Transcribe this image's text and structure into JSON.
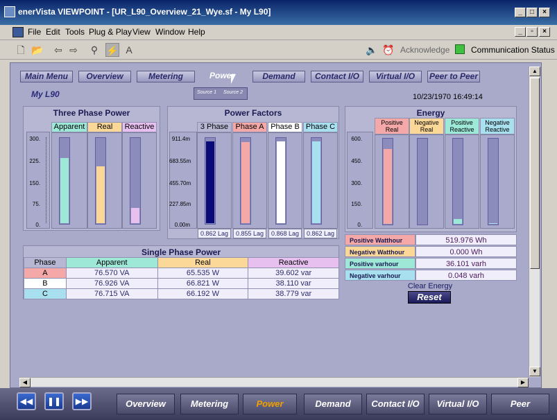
{
  "window": {
    "title": "enerVista VIEWPOINT - [UR_L90_Overview_21_Wye.sf - My L90]"
  },
  "menu": [
    "File",
    "Edit",
    "Tools",
    "Plug & Play",
    "View",
    "Window",
    "Help"
  ],
  "toolbar": {
    "acknowledge": "Acknowledge",
    "comm_status": "Communication Status"
  },
  "nav": [
    "Main Menu",
    "Overview",
    "Metering",
    "Power",
    "Demand",
    "Contact I/O",
    "Virtual I/O",
    "Peer to Peer"
  ],
  "device": "My L90",
  "timestamp": "10/23/1970 16:49:14",
  "source": {
    "s1": "Source 1",
    "s2": "Source 2"
  },
  "three_phase": {
    "title": "Three Phase Power",
    "labels": [
      "Apparent",
      "Real",
      "Reactive"
    ],
    "scale": [
      "300.",
      "225.",
      "150.",
      "75.",
      "0."
    ],
    "levels": [
      0.76,
      0.66,
      0.18
    ]
  },
  "power_factors": {
    "title": "Power Factors",
    "labels": [
      "3 Phase",
      "Phase A",
      "Phase B",
      "Phase C"
    ],
    "scale": [
      "911.4m",
      "683.55m",
      "455.70m",
      "227.85m",
      "0.00m"
    ],
    "values": [
      "0.862 Lag",
      "0.855 Lag",
      "0.868 Lag",
      "0.862 Lag"
    ],
    "levels": [
      0.95,
      0.94,
      0.95,
      0.95
    ]
  },
  "energy": {
    "title": "Energy",
    "labels": [
      "Positive Real",
      "Negative Real",
      "Positive Reactive",
      "Negative Reactive"
    ],
    "scale": [
      "600.",
      "450.",
      "300.",
      "150.",
      "0."
    ],
    "levels": [
      0.87,
      0,
      0.06,
      0.01
    ],
    "rows": [
      {
        "label": "Positive Watthour",
        "value": "519.976 Wh"
      },
      {
        "label": "Negative Watthour",
        "value": "0.000 Wh"
      },
      {
        "label": "Positive varhour",
        "value": "36.101 varh"
      },
      {
        "label": "Negative varhour",
        "value": "0.048 varh"
      }
    ],
    "clear_label": "Clear Energy",
    "reset": "Reset"
  },
  "single_phase": {
    "title": "Single Phase Power",
    "headers": [
      "Phase",
      "Apparent",
      "Real",
      "Reactive"
    ],
    "rows": [
      [
        "A",
        "76.570 VA",
        "65.535 W",
        "39.602 var"
      ],
      [
        "B",
        "76.926 VA",
        "66.821 W",
        "38.110 var"
      ],
      [
        "C",
        "76.715 VA",
        "66.192 W",
        "38.779 var"
      ]
    ]
  },
  "bottom_tabs": [
    "Overview",
    "Metering",
    "Power",
    "Demand",
    "Contact I/O",
    "Virtual I/O",
    "Peer"
  ],
  "colors": {
    "apparent": "#9ee8d8",
    "real": "#fcd898",
    "reactive": "#e8c0f0",
    "phaseA": "#f4a8a8",
    "phaseB": "#ffffff",
    "phaseC": "#a8e0f0",
    "three": "#0a0a78"
  }
}
